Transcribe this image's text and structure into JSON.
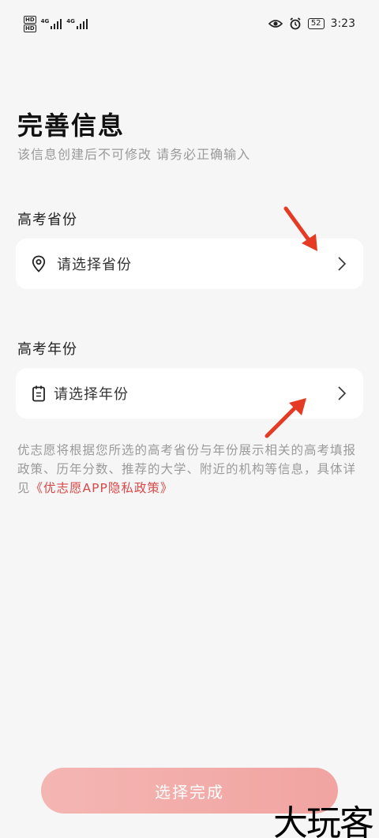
{
  "status_bar": {
    "sim1_tag": "HD",
    "sim2_tag": "HD",
    "net1": "4G",
    "net2": "4G",
    "battery": "52",
    "time": "3:23",
    "icons": [
      "eye-icon",
      "alarm-icon"
    ]
  },
  "header": {
    "title": "完善信息",
    "subtitle": "该信息创建后不可修改  请务必正确输入"
  },
  "province": {
    "label": "高考省份",
    "placeholder": "请选择省份",
    "icon": "location-pin-icon"
  },
  "year": {
    "label": "高考年份",
    "placeholder": "请选择年份",
    "icon": "calendar-icon"
  },
  "notice": {
    "text": "优志愿将根据您所选的高考省份与年份展示相关的高考填报政策、历年分数、推荐的大学、附近的机构等信息，具体详见",
    "link": "《优志愿APP隐私政策》",
    "link_color": "#d94848"
  },
  "footer": {
    "done_label": "选择完成",
    "button_color": "#f2aaa7"
  },
  "watermark": {
    "text": "大玩客"
  },
  "annotation_arrows": {
    "color": "#e53a24"
  }
}
